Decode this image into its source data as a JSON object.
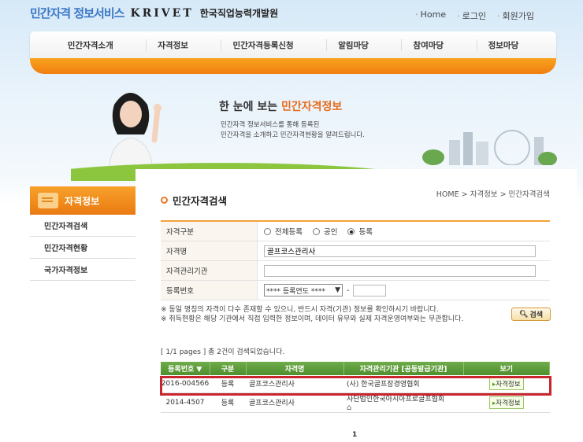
{
  "header": {
    "logo_main": "민간자격 정보서비스",
    "logo_krivet": "KRIVET",
    "logo_institute": "한국직업능력개발원",
    "util_links": [
      "Home",
      "로그인",
      "회원가입"
    ]
  },
  "nav": {
    "items": [
      "민간자격소개",
      "자격정보",
      "민간자격등록신청",
      "알림마당",
      "참여마당",
      "정보마당"
    ]
  },
  "banner": {
    "title_prefix": "한 눈에 보는 ",
    "title_highlight": "민간자격정보",
    "desc_line1": "민간자격 정보서비스를 통해 등록된",
    "desc_line2": "민간자격을 소개하고 민간자격현황을 알려드립니다."
  },
  "sidebar": {
    "title": "자격정보",
    "items": [
      "민간자격검색",
      "민간자격현황",
      "국가자격정보"
    ]
  },
  "main": {
    "page_title": "민간자격검색",
    "breadcrumb": "HOME > 자격정보 > 민간자격검색",
    "form": {
      "type_label": "자격구분",
      "type_options": [
        "전체등록",
        "공인",
        "등록"
      ],
      "type_selected": "등록",
      "name_label": "자격명",
      "name_value": "골프코스관리사",
      "org_label": "자격관리기관",
      "org_value": "",
      "regno_label": "등록번호",
      "regno_select": "**** 등록연도 ****",
      "regno_sep": "-"
    },
    "note_line1": "※ 동일 명칭의 자격이 다수 존재할 수 있으니, 반드시 자격(기관) 정보를 확인하시기 바랍니다.",
    "note_line2": "※ 취득현황은 해당 기관에서 직접 입력한 정보이며, 데이터 유무와 실제 자격운영여부와는 무관합니다.",
    "search_button": "검색",
    "result_count": "[ 1/1 pages ] 총 2건이 검색되었습니다.",
    "table": {
      "headers": [
        "등록번호 ▼",
        "구분",
        "자격명",
        "자격관리기관 [공동발급기관]",
        "보기"
      ],
      "rows": [
        {
          "regno": "2016-004566",
          "type": "등록",
          "name": "골프코스관리사",
          "org": "(사) 한국골프장경영협회",
          "view": "자격정보"
        },
        {
          "regno": "2014-4507",
          "type": "등록",
          "name": "골프코스관리사",
          "org": "사단법인한국아시아프로골프협회",
          "view": "자격정보"
        }
      ]
    },
    "page": "1"
  },
  "colors": {
    "accent_orange": "#f08a17",
    "table_green": "#5a9a36",
    "highlight_red": "#c8262c"
  }
}
